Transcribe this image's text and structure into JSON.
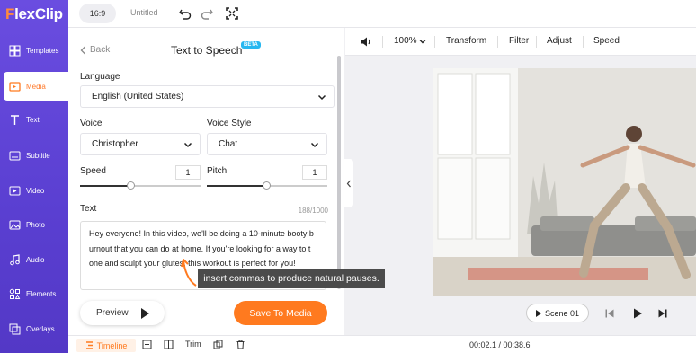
{
  "app": {
    "logo_text_f": "F",
    "logo_text_rest": "lexClip"
  },
  "topbar": {
    "ratio": "16:9",
    "title": "Untitled"
  },
  "sidebar": {
    "items": [
      {
        "label": "Templates",
        "icon": "templates-icon"
      },
      {
        "label": "Media",
        "icon": "media-icon",
        "active": true
      },
      {
        "label": "Text",
        "icon": "text-icon"
      },
      {
        "label": "Subtitle",
        "icon": "subtitle-icon"
      },
      {
        "label": "Video",
        "icon": "video-icon"
      },
      {
        "label": "Photo",
        "icon": "photo-icon"
      },
      {
        "label": "Audio",
        "icon": "audio-icon"
      },
      {
        "label": "Elements",
        "icon": "elements-icon"
      },
      {
        "label": "Overlays",
        "icon": "overlays-icon"
      }
    ]
  },
  "panel": {
    "back": "Back",
    "title": "Text to Speech",
    "beta": "BETA",
    "language_label": "Language",
    "language_value": "English (United States)",
    "voice_label": "Voice",
    "voice_value": "Christopher",
    "voice_style_label": "Voice Style",
    "voice_style_value": "Chat",
    "speed_label": "Speed",
    "speed_value": "1",
    "speed_level": 0.5,
    "pitch_label": "Pitch",
    "pitch_value": "1",
    "pitch_level": 0.5,
    "text_label": "Text",
    "text_counter": "188/1000",
    "text_lines": [
      "Hey everyone! In this video, we'll be doing a 10-minute booty b",
      "urnout that you can do at home. If you're looking for a way to t",
      "one and sculpt your glutes, this workout is perfect for you!"
    ],
    "preview_button": "Preview",
    "save_button": "Save To Media"
  },
  "tooltip": {
    "text": "insert commas to produce natural pauses."
  },
  "canvas_toolbar": {
    "zoom": "100%",
    "transform": "Transform",
    "filter": "Filter",
    "adjust": "Adjust",
    "speed": "Speed"
  },
  "player": {
    "scene": "Scene 01"
  },
  "bottombar": {
    "timeline": "Timeline",
    "trim": "Trim",
    "time": "00:02.1 / 00:38.6"
  },
  "colors": {
    "sidebar": "#5a3fd1",
    "accent": "#ff7a1f",
    "beta": "#27b7f0"
  }
}
